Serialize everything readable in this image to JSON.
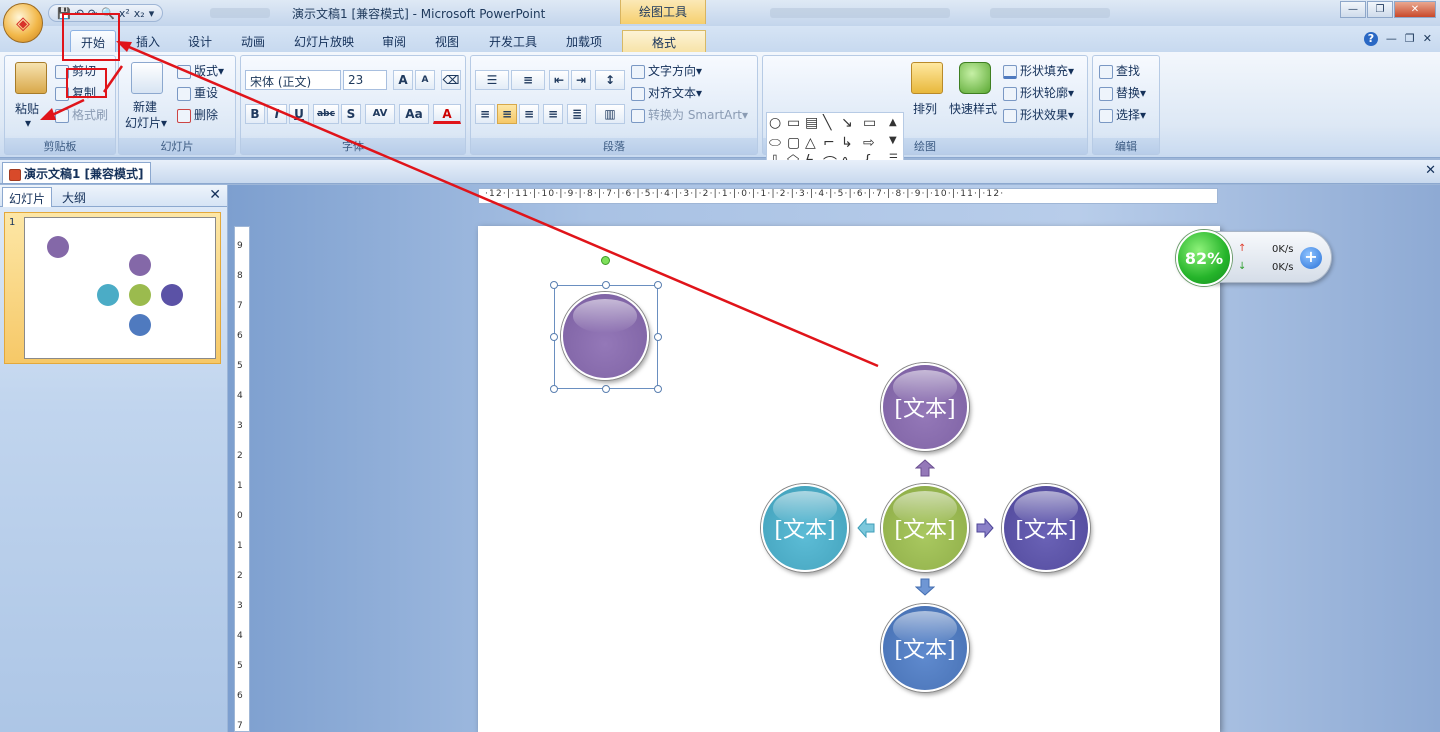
{
  "window": {
    "title": "演示文稿1 [兼容模式] - Microsoft PowerPoint",
    "context_tab": "绘图工具",
    "qat": [
      "💾",
      "↶",
      "↷",
      "🔍",
      "x²",
      "x₂",
      "▾"
    ],
    "controls": [
      "—",
      "❐",
      "✕"
    ]
  },
  "tabs": {
    "items": [
      "开始",
      "插入",
      "设计",
      "动画",
      "幻灯片放映",
      "审阅",
      "视图",
      "开发工具",
      "加载项",
      "格式"
    ],
    "help": "?"
  },
  "ribbon": {
    "clipboard": {
      "label": "剪贴板",
      "paste": "粘贴",
      "cut": "剪切",
      "copy": "复制",
      "format_painter": "格式刷"
    },
    "slides": {
      "label": "幻灯片",
      "new_slide_l1": "新建",
      "new_slide_l2": "幻灯片▾",
      "layout": "版式▾",
      "reset": "重设",
      "delete": "删除"
    },
    "font": {
      "label": "字体",
      "font_name": "宋体 (正文)",
      "font_size": "23",
      "bold": "B",
      "italic": "I",
      "underline": "U",
      "strike": "abc",
      "shadow": "S",
      "spacing": "AV",
      "case": "Aa",
      "color": "A",
      "grow": "A",
      "shrink": "A"
    },
    "paragraph": {
      "label": "段落",
      "text_direction": "文字方向▾",
      "align_text": "对齐文本▾",
      "convert_smartart": "转换为 SmartArt▾"
    },
    "drawing": {
      "label": "绘图",
      "arrange": "排列",
      "quick_styles": "快速样式",
      "shape_fill": "形状填充▾",
      "shape_outline": "形状轮廓▾",
      "shape_effects": "形状效果▾"
    },
    "editing": {
      "label": "编辑",
      "find": "查找",
      "replace": "替换▾",
      "select": "选择▾"
    }
  },
  "doc_tab": "演示文稿1 [兼容模式]",
  "left_panel": {
    "tab_slides": "幻灯片",
    "tab_outline": "大纲",
    "slide_number": "1"
  },
  "ruler_h": "·12·|·11·|·10·|·9·|·8·|·7·|·6·|·5·|·4·|·3·|·2·|·1·|·0·|·1·|·2·|·3·|·4·|·5·|·6·|·7·|·8·|·9·|·10·|·11·|·12·",
  "ruler_v": [
    "9",
    "8",
    "7",
    "6",
    "5",
    "4",
    "3",
    "2",
    "1",
    "0",
    "1",
    "2",
    "3",
    "4",
    "5",
    "6",
    "7"
  ],
  "slide": {
    "placeholder": "[文本]"
  },
  "netmon": {
    "percent": "82%",
    "up": "0K/s",
    "down": "0K/s",
    "up_arrow": "↑",
    "down_arrow": "↓",
    "plus": "+"
  },
  "colors": {
    "purple": "#8468a8",
    "green": "#9bbb4e",
    "teal": "#4bacc6",
    "indigo": "#5b52a6",
    "blue": "#4f7abf",
    "red": "#e0141a"
  }
}
